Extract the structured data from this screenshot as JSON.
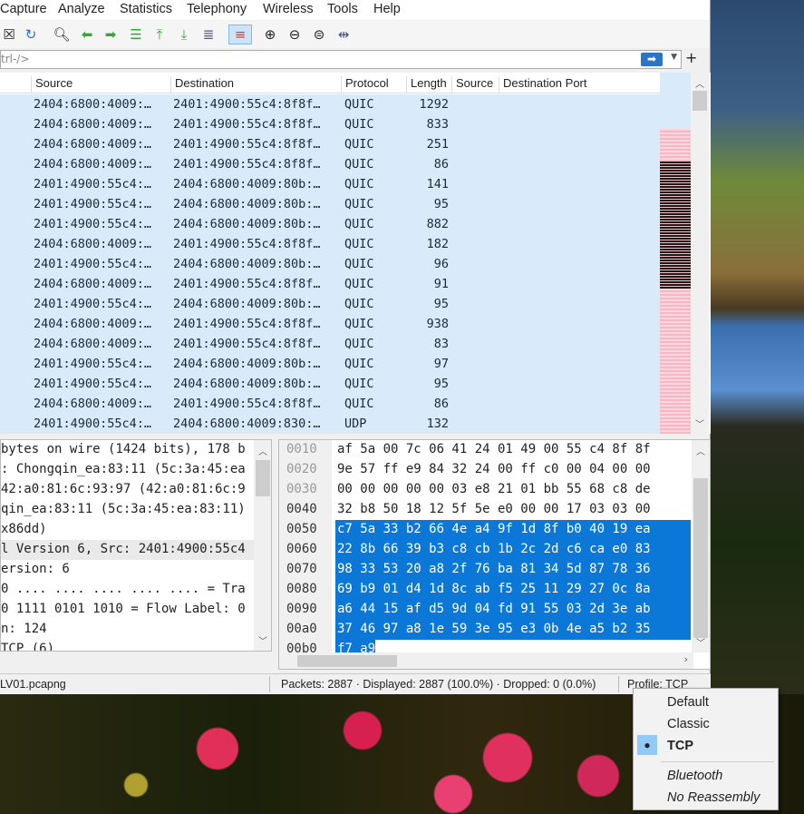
{
  "menu": [
    "Capture",
    "Analyze",
    "Statistics",
    "Telephony",
    "Wireless",
    "Tools",
    "Help"
  ],
  "filter": {
    "placeholder": "trl-/>",
    "apply_icon": "arrow-right-icon",
    "plus": "+"
  },
  "columns": [
    "Source",
    "Destination",
    "Protocol",
    "Length",
    "Source",
    "Destination Port"
  ],
  "packets": [
    [
      "2404:6800:4009:…",
      "2401:4900:55c4:8f8f…",
      "QUIC",
      "1292"
    ],
    [
      "2404:6800:4009:…",
      "2401:4900:55c4:8f8f…",
      "QUIC",
      "833"
    ],
    [
      "2404:6800:4009:…",
      "2401:4900:55c4:8f8f…",
      "QUIC",
      "251"
    ],
    [
      "2404:6800:4009:…",
      "2401:4900:55c4:8f8f…",
      "QUIC",
      "86"
    ],
    [
      "2401:4900:55c4:…",
      "2404:6800:4009:80b:…",
      "QUIC",
      "141"
    ],
    [
      "2401:4900:55c4:…",
      "2404:6800:4009:80b:…",
      "QUIC",
      "95"
    ],
    [
      "2401:4900:55c4:…",
      "2404:6800:4009:80b:…",
      "QUIC",
      "882"
    ],
    [
      "2404:6800:4009:…",
      "2401:4900:55c4:8f8f…",
      "QUIC",
      "182"
    ],
    [
      "2401:4900:55c4:…",
      "2404:6800:4009:80b:…",
      "QUIC",
      "96"
    ],
    [
      "2404:6800:4009:…",
      "2401:4900:55c4:8f8f…",
      "QUIC",
      "91"
    ],
    [
      "2401:4900:55c4:…",
      "2404:6800:4009:80b:…",
      "QUIC",
      "95"
    ],
    [
      "2404:6800:4009:…",
      "2401:4900:55c4:8f8f…",
      "QUIC",
      "938"
    ],
    [
      "2404:6800:4009:…",
      "2401:4900:55c4:8f8f…",
      "QUIC",
      "83"
    ],
    [
      "2401:4900:55c4:…",
      "2404:6800:4009:80b:…",
      "QUIC",
      "97"
    ],
    [
      "2401:4900:55c4:…",
      "2404:6800:4009:80b:…",
      "QUIC",
      "95"
    ],
    [
      "2404:6800:4009:…",
      "2401:4900:55c4:8f8f…",
      "QUIC",
      "86"
    ],
    [
      "2401:4900:55c4:…",
      "2404:6800:4009:830:…",
      "UDP",
      "132"
    ]
  ],
  "details": [
    "bytes on wire (1424 bits), 178 b",
    ": Chongqin_ea:83:11 (5c:3a:45:ea",
    "42:a0:81:6c:93:97 (42:a0:81:6c:9",
    "qin_ea:83:11 (5c:3a:45:ea:83:11)",
    "x86dd)",
    "l Version 6, Src: 2401:4900:55c4",
    "ersion: 6",
    "0 .... .... .... .... .... = Tra",
    "0 1111 0101 1010 = Flow Label: 0",
    "n: 124",
    "TCP (6)"
  ],
  "bytes": [
    {
      "off": "0010",
      "hex": "af 5a 00 7c 06 41 24 01  49 00 55 c4 8f 8f",
      "sel": false
    },
    {
      "off": "0020",
      "hex": "9e 57 ff e9 84 32 24 00  ff c0 00 04 00 00",
      "sel": false
    },
    {
      "off": "0030",
      "hex": "00 00 00 00 00 03 e8 21  01 bb 55 68 c8 de",
      "sel": false
    },
    {
      "off": "0040",
      "hex": "32 b8 50 18 12 5f 5e e0  00 00 17 03 03 00",
      "sel": false
    },
    {
      "off": "0050",
      "hex": "c7 5a 33 b2 66 4e a4 9f  1d 8f b0 40 19 ea",
      "sel": true
    },
    {
      "off": "0060",
      "hex": "22 8b 66 39 b3 c8 cb 1b  2c 2d c6 ca e0 83",
      "sel": true
    },
    {
      "off": "0070",
      "hex": "98 33 53 20 a8 2f 76 ba  81 34 5d 87 78 36",
      "sel": true
    },
    {
      "off": "0080",
      "hex": "69 b9 01 d4 1d 8c ab f5  25 11 29 27 0c 8a",
      "sel": true
    },
    {
      "off": "0090",
      "hex": "a6 44 15 af d5 9d 04 fd  91 55 03 2d 3e ab",
      "sel": true
    },
    {
      "off": "00a0",
      "hex": "37 46 97 a8 1e 59 3e 95  e3 0b 4e a5 b2 35",
      "sel": true
    },
    {
      "off": "00b0",
      "hex": "f7 a9",
      "sel": true
    }
  ],
  "status": {
    "file": "LV01.pcapng",
    "packets": "Packets: 2887 · Displayed: 2887 (100.0%) · Dropped: 0 (0.0%)",
    "profile": "Profile: TCP"
  },
  "profile_menu": {
    "items": [
      "Default",
      "Classic",
      "TCP"
    ],
    "selected": "TCP",
    "sub_items": [
      "Bluetooth",
      "No Reassembly"
    ]
  }
}
